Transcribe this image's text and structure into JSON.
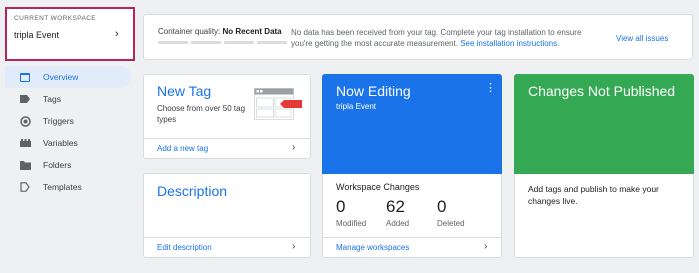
{
  "workspace": {
    "caption": "CURRENT WORKSPACE",
    "name": "tripla Event"
  },
  "sidebar": {
    "items": [
      {
        "label": "Overview",
        "icon": "overview-icon",
        "active": true
      },
      {
        "label": "Tags",
        "icon": "tag-icon"
      },
      {
        "label": "Triggers",
        "icon": "trigger-icon"
      },
      {
        "label": "Variables",
        "icon": "variables-icon"
      },
      {
        "label": "Folders",
        "icon": "folder-icon"
      },
      {
        "label": "Templates",
        "icon": "template-icon"
      }
    ]
  },
  "banner": {
    "quality_label": "Container quality:",
    "quality_value": "No Recent Data",
    "message": "No data has been received from your tag. Complete your tag installation to ensure you're getting the most accurate measurement.",
    "message_link": "See installation instructions.",
    "view_issues": "View all issues"
  },
  "new_tag": {
    "title": "New Tag",
    "text": "Choose from over 50 tag types",
    "link": "Add a new tag"
  },
  "description": {
    "title": "Description",
    "link": "Edit description"
  },
  "now_editing": {
    "title": "Now Editing",
    "workspace": "tripla Event",
    "changes_title": "Workspace Changes",
    "stats": [
      {
        "value": "0",
        "label": "Modified"
      },
      {
        "value": "62",
        "label": "Added"
      },
      {
        "value": "0",
        "label": "Deleted"
      }
    ],
    "link": "Manage workspaces"
  },
  "not_published": {
    "title": "Changes Not Published",
    "text": "Add tags and publish to make your changes live."
  },
  "colors": {
    "accent_blue": "#1a73e8",
    "green": "#34a853",
    "highlight_border": "#b5245a",
    "red_arrow": "#e53935"
  }
}
